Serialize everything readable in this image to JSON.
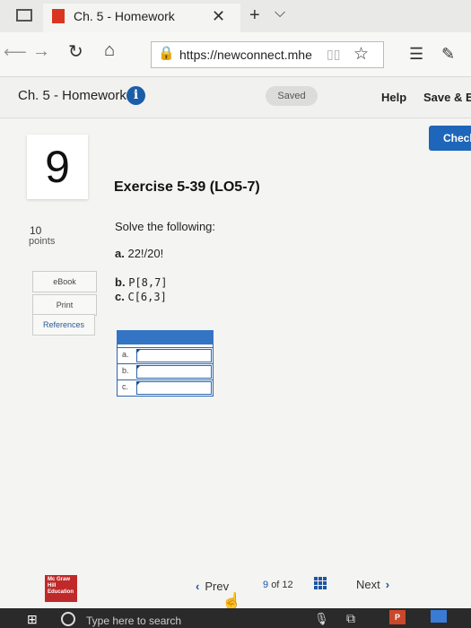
{
  "browser": {
    "tab_title": "Ch. 5 - Homework",
    "tab_close": "✕",
    "new_tab": "+",
    "tab_dropdown": "⌵",
    "nav_back": "⟵",
    "nav_forward": "→",
    "refresh": "↻",
    "home": "⌂",
    "lock": "🔒",
    "url": "https://newconnect.mhe",
    "reading_view": "▯▯",
    "star": "☆",
    "favorites": "☰",
    "pen": "✎"
  },
  "header": {
    "title": "Ch. 5 - Homework",
    "info": "i",
    "saved": "Saved",
    "help": "Help",
    "save_exit": "Save & Ex",
    "check": "Check"
  },
  "question": {
    "number": "9",
    "title": "Exercise 5-39 (LO5-7)",
    "points_value": "10",
    "points_label": "points",
    "instruction": "Solve the following:",
    "parts": [
      {
        "label": "a.",
        "expr": "22!/20!"
      },
      {
        "label": "b.",
        "expr": "P[8,7]"
      },
      {
        "label": "c.",
        "expr": "C[6,3]"
      }
    ]
  },
  "resources": {
    "ebook": "eBook",
    "print": "Print",
    "references": "References"
  },
  "answer_table": {
    "rows": [
      {
        "label": "a.",
        "value": ""
      },
      {
        "label": "b.",
        "value": ""
      },
      {
        "label": "c.",
        "value": ""
      }
    ]
  },
  "footer": {
    "logo": "Mc Graw Hill Education",
    "prev": "Prev",
    "prev_arrow": "‹",
    "page_current": "9",
    "page_of": "of 12",
    "next": "Next",
    "next_arrow": "›"
  },
  "taskbar": {
    "windows": "⊞",
    "search_placeholder": "Type here to search",
    "mic": "🎙",
    "taskview": "⧉",
    "ppt": "P"
  },
  "colors": {
    "accent_blue": "#1d66b9",
    "brand_red": "#c0292a"
  }
}
